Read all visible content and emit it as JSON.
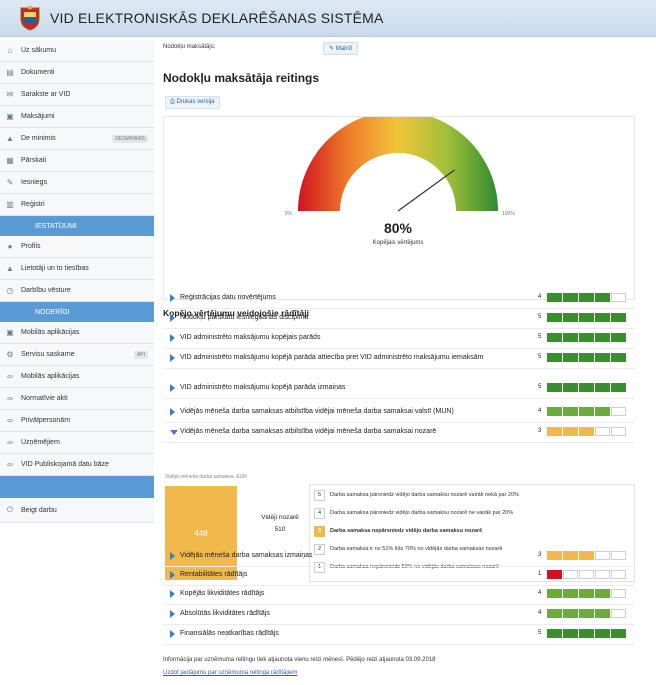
{
  "header": {
    "title": "VID ELEKTRONISKĀS DEKLARĒŠANAS SISTĒMA"
  },
  "sidebar": {
    "items": [
      {
        "label": "Uz sākumu",
        "icon": "home-icon",
        "glyph": "⌂"
      },
      {
        "label": "Dokumenti",
        "icon": "document-icon",
        "glyph": "▤"
      },
      {
        "label": "Sarakste ar VID",
        "icon": "mail-icon",
        "glyph": "✉"
      },
      {
        "label": "Maksājumi",
        "icon": "payment-icon",
        "glyph": "▣"
      },
      {
        "label": "De minimis",
        "icon": "warning-icon",
        "glyph": "▲",
        "badge": "DESMINIMIS"
      },
      {
        "label": "Pārskati",
        "icon": "report-icon",
        "glyph": "▦"
      },
      {
        "label": "Iesniegs",
        "icon": "edit-icon",
        "glyph": "✎"
      },
      {
        "label": "Reģistri",
        "icon": "grid-icon",
        "glyph": "▥"
      }
    ],
    "section_settings": "IESTATĪJUMI",
    "settings_items": [
      {
        "label": "Profils",
        "icon": "user-icon",
        "glyph": "●"
      },
      {
        "label": "Lietotāji un to tiesības",
        "icon": "users-icon",
        "glyph": "▲"
      },
      {
        "label": "Darbību vēsture",
        "icon": "history-icon",
        "glyph": "◷"
      }
    ],
    "section_useful": "NODERĪGI",
    "useful_items": [
      {
        "label": "Mobilās aplikācijas",
        "icon": "mobile-icon",
        "glyph": "▣"
      },
      {
        "label": "Servisu saskarne",
        "icon": "api-icon",
        "glyph": "⚙",
        "badge": "API"
      },
      {
        "label": "Mobilās aplikācijas",
        "icon": "link-icon",
        "glyph": "∞"
      },
      {
        "label": "Normatīvie akti",
        "icon": "link-icon",
        "glyph": "∞"
      },
      {
        "label": "Privātpersonām",
        "icon": "link-icon",
        "glyph": "∞"
      },
      {
        "label": "Uzņēmējiem",
        "icon": "link-icon",
        "glyph": "∞"
      },
      {
        "label": "VID Publiskojamā datu bāze",
        "icon": "link-icon",
        "glyph": "∞"
      }
    ],
    "logout": {
      "label": "Beigt darbu",
      "icon": "power-icon",
      "glyph": "⏻"
    }
  },
  "taxpayer": {
    "label": "Nodokļu maksātājs:",
    "change_label": "Mainīt"
  },
  "page": {
    "title": "Nodokļu maksātāja reitings",
    "print_label": "Drukas versija"
  },
  "gauge": {
    "value": 80,
    "value_text": "80%",
    "caption": "Kopējais vērtējums",
    "min_label": "0%",
    "max_label": "100%"
  },
  "indicators_title": "Kopējo vērtējumu veidojošie rādītāji",
  "colors": {
    "green": "#3a8e2f",
    "light_green": "#6aab3c",
    "orange": "#f1b84c",
    "red": "#d2121f",
    "empty": "#ffffff",
    "accent": "#5b9bd5"
  },
  "indicators": [
    {
      "name": "Reģistrācijas datu novērtējums",
      "score": "4",
      "segments": [
        "green",
        "green",
        "green",
        "green",
        "empty"
      ]
    },
    {
      "name": "Nodokļu pārskatu iesniegšanas disciplīna",
      "score": "5",
      "segments": [
        "green",
        "green",
        "green",
        "green",
        "green"
      ]
    },
    {
      "name": "VID administrēto maksājumu kopējais parāds",
      "score": "5",
      "segments": [
        "green",
        "green",
        "green",
        "green",
        "green"
      ]
    },
    {
      "name": "VID administrēto maksājumu kopējā parāda attiecība pret VID administrēto maksājumu iemaksām",
      "score": "5",
      "segments": [
        "green",
        "green",
        "green",
        "green",
        "green"
      ]
    },
    {
      "name": "VID administrēto maksājumu kopējā parāda izmaiņas",
      "score": "5",
      "segments": [
        "green",
        "green",
        "green",
        "green",
        "green"
      ]
    },
    {
      "name": "Vidējās mēneša darba samaksas atbilstība vidējai mēneša darba samaksai valstī (MUN)",
      "score": "4",
      "segments": [
        "light_green",
        "light_green",
        "light_green",
        "light_green",
        "empty"
      ]
    },
    {
      "name": "Vidējās mēneša darba samaksas atbilstība vidējai mēneša darba samaksai nozarē",
      "score": "3",
      "segments": [
        "orange",
        "orange",
        "orange",
        "empty",
        "empty"
      ],
      "expanded": true
    }
  ],
  "detail": {
    "note": "Vidējā mēneša darba samaksa, EUR",
    "value": "448",
    "avg_label": "Vidēji nozarē",
    "avg_value": "510",
    "scale": [
      {
        "num": "5",
        "text": "Darba samaksa pārsniedz vidējo darba samaksu nozarē vairāk nekā par 20%"
      },
      {
        "num": "4",
        "text": "Darba samaksa pārsniedz vidējo darba samaksu nozarē ne vairāk par 20%"
      },
      {
        "num": "3",
        "text": "Darba samaksa nepārsniedz vidējo darba samaksu nozarē",
        "active": true
      },
      {
        "num": "2",
        "text": "Darba samaksa ir no 51% līdz 70% no vidējās darba samaksas nozarē"
      },
      {
        "num": "1",
        "text": "Darba samaksa nepārsniedz 50% no vidējās darba samaksas nozarē"
      }
    ]
  },
  "indicators_after": [
    {
      "name": "Vidējās mēneša darba samaksas izmaiņas",
      "score": "3",
      "segments": [
        "orange",
        "orange",
        "orange",
        "empty",
        "empty"
      ]
    },
    {
      "name": "Rentabilitātes rādītājs",
      "score": "1",
      "segments": [
        "red",
        "empty",
        "empty",
        "empty",
        "empty"
      ]
    },
    {
      "name": "Kopējās likviditātes rādītājs",
      "score": "4",
      "segments": [
        "light_green",
        "light_green",
        "light_green",
        "light_green",
        "empty"
      ]
    },
    {
      "name": "Absolūtās likviditātes rādītājs",
      "score": "4",
      "segments": [
        "light_green",
        "light_green",
        "light_green",
        "light_green",
        "empty"
      ]
    },
    {
      "name": "Finansiālās neatkarības rādītājs",
      "score": "5",
      "segments": [
        "green",
        "green",
        "green",
        "green",
        "green"
      ]
    }
  ],
  "footer": {
    "note": "Informācija par uzņēmuma reitingu tiek atjaunota vienu reizi mēnesī. Pēdējo reizi atjaunota 03.09.2018",
    "link": "Uzdot jautājumu par uzņēmuma reitinga rādītājiem"
  }
}
